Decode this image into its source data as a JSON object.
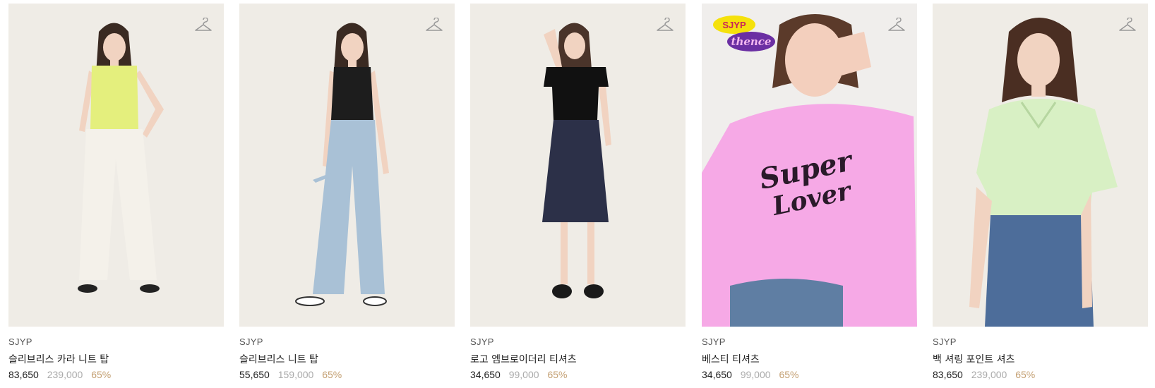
{
  "products": [
    {
      "brand": "SJYP",
      "name": "슬리브리스 카라 니트 탑",
      "sale_price": "83,650",
      "original_price": "239,000",
      "discount": "65%",
      "top_color": "#e4ef7d",
      "bottom_color": "#f4f1ea",
      "shoe_color": "#222222"
    },
    {
      "brand": "SJYP",
      "name": "슬리브리스 니트 탑",
      "sale_price": "55,650",
      "original_price": "159,000",
      "discount": "65%",
      "top_color": "#1d1d1d",
      "bottom_color": "#a9c1d6",
      "shoe_color": "#ffffff"
    },
    {
      "brand": "SJYP",
      "name": "로고 엠브로이더리 티셔츠",
      "sale_price": "34,650",
      "original_price": "99,000",
      "discount": "65%",
      "top_color": "#111111",
      "bottom_color": "#2c3048",
      "shoe_color": "#1a1a1a"
    },
    {
      "brand": "SJYP",
      "name": "베스티 티셔츠",
      "sale_price": "34,650",
      "original_price": "99,000",
      "discount": "65%",
      "top_color": "#f6a9e6",
      "bottom_color": "#5f7ea3",
      "badge": {
        "line1": "SJYP",
        "line2": "thence"
      }
    },
    {
      "brand": "SJYP",
      "name": "백 셔링 포인트 셔츠",
      "sale_price": "83,650",
      "original_price": "239,000",
      "discount": "65%",
      "top_color": "#d8f0c4",
      "bottom_color": "#4d6d9a"
    }
  ],
  "colors": {
    "discount": "#c4a073",
    "original_price": "#aaaaaa",
    "image_bg": "#efece6"
  },
  "icons": {
    "wishlist": "hanger-icon"
  }
}
